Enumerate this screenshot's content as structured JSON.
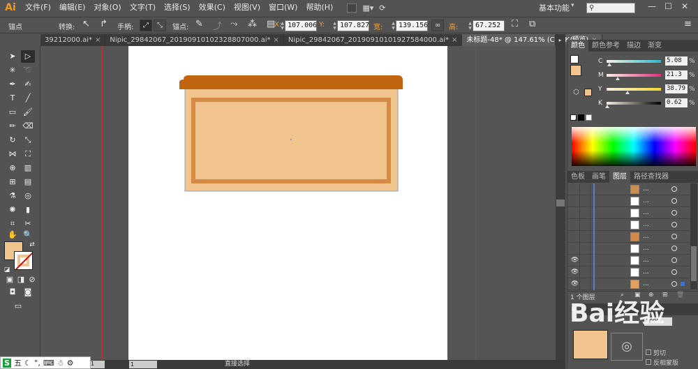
{
  "app": {
    "logo": "Ai"
  },
  "menu": [
    "文件(F)",
    "编辑(E)",
    "对象(O)",
    "文字(T)",
    "选择(S)",
    "效果(C)",
    "视图(V)",
    "窗口(W)",
    "帮助(H)"
  ],
  "workspace": "基本功能",
  "control": {
    "anchor_label": "锚点",
    "convert_label": "转换:",
    "handle_label": "手柄:",
    "anchor2_label": "锚点:",
    "x_label": "X:",
    "x_value": "107.006",
    "y_label": "Y:",
    "y_value": "107.827",
    "w_label": "宽:",
    "w_value": "139.156",
    "h_label": "高:",
    "h_value": "67.252"
  },
  "tabs": [
    {
      "label": "39212000.ai*",
      "active": false
    },
    {
      "label": "Nipic_29842067_20190910102328807000.ai*",
      "active": false
    },
    {
      "label": "Nipic_29842067_20190910101927584000.ai*",
      "active": false
    },
    {
      "label": "未标题-48* @ 147.61% (CMYK/预览)",
      "active": true
    }
  ],
  "colors": {
    "fill": "#f0c48c",
    "roof": "#c0640e",
    "frame": "#d58b45",
    "inner": "#f0c48c"
  },
  "color_panel": {
    "tabs": [
      "颜色",
      "颜色参考",
      "描边",
      "渐变"
    ],
    "channels": [
      {
        "label": "C",
        "value": "5.08",
        "unit": "%",
        "level": 0.05
      },
      {
        "label": "M",
        "value": "21.3",
        "unit": "%",
        "level": 0.21
      },
      {
        "label": "Y",
        "value": "38.79",
        "unit": "%",
        "level": 0.39
      },
      {
        "label": "K",
        "value": "0.62",
        "unit": "%",
        "level": 0.01
      }
    ]
  },
  "layers_panel": {
    "tabs": [
      "色板",
      "画笔",
      "图层",
      "路径查找器"
    ],
    "rows": [
      {
        "name": "...",
        "eye": false,
        "thumb": "#c89050"
      },
      {
        "name": "...",
        "eye": false,
        "thumb": "#ffffff"
      },
      {
        "name": "...",
        "eye": false,
        "thumb": "#ffffff"
      },
      {
        "name": "...",
        "eye": false,
        "thumb": "#ffffff"
      },
      {
        "name": "...",
        "eye": false,
        "thumb": "#d08a4a"
      },
      {
        "name": "...",
        "eye": false,
        "thumb": "#ffffff"
      },
      {
        "name": "...",
        "eye": true,
        "thumb": "#ffffff"
      },
      {
        "name": "...",
        "eye": true,
        "thumb": "#ffffff"
      },
      {
        "name": "...",
        "eye": true,
        "thumb": "#e0a060"
      }
    ],
    "footer": "1 个图层"
  },
  "transparency": {
    "opacity": "100%",
    "clip": "剪切",
    "invert": "反相蒙版"
  },
  "status": {
    "zoom": "1",
    "page": "1",
    "tool": "直接选择"
  },
  "ime": {
    "label": "五"
  }
}
